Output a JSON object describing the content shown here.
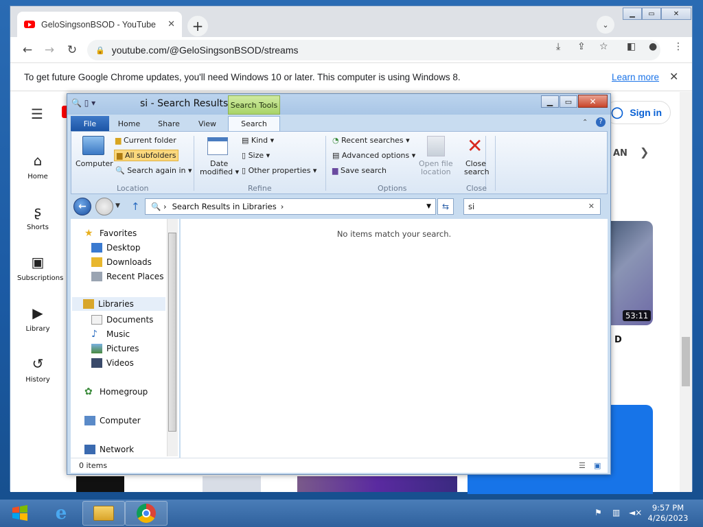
{
  "browser": {
    "tab_title": "GeloSingsonBSOD - YouTube",
    "tab_close": "✕",
    "new_tab": "+",
    "url": "youtube.com/@GeloSingsonBSOD/streams",
    "window_controls": [
      "▁",
      "▭",
      "✕"
    ]
  },
  "infobar": {
    "message": "To get future Google Chrome updates, you'll need Windows 10 or later. This computer is using Windows 8.",
    "learn_more": "Learn more",
    "close": "✕"
  },
  "youtube": {
    "sign_in": "Sign in",
    "sidebar": [
      {
        "label": "Home",
        "icon": "home-icon"
      },
      {
        "label": "Shorts",
        "icon": "shorts-icon"
      },
      {
        "label": "Subscriptions",
        "icon": "subscriptions-icon"
      },
      {
        "label": "Library",
        "icon": "library-icon"
      },
      {
        "label": "History",
        "icon": "history-icon"
      }
    ],
    "chip_text": "AN",
    "video_duration": "53:11",
    "video_title_fragment": "D"
  },
  "explorer": {
    "title": "si - Search Results...",
    "search_tools_label": "Search Tools",
    "ribbon_tabs": [
      "File",
      "Home",
      "Share",
      "View",
      "Search"
    ],
    "ribbon": {
      "computer": "Computer",
      "current_folder": "Current folder",
      "all_subfolders": "All subfolders",
      "search_again_in": "Search again in",
      "location_group": "Location",
      "date_modified_1": "Date",
      "date_modified_2": "modified",
      "kind": "Kind",
      "size": "Size",
      "other_properties": "Other properties",
      "refine_group": "Refine",
      "recent_searches": "Recent searches",
      "advanced_options": "Advanced options",
      "save_search": "Save search",
      "options_group": "Options",
      "open_file_location_1": "Open file",
      "open_file_location_2": "location",
      "close_search_1": "Close",
      "close_search_2": "search",
      "close_group": "Close"
    },
    "address": "Search Results in Libraries",
    "search_value": "si",
    "nav": {
      "favorites": "Favorites",
      "desktop": "Desktop",
      "downloads": "Downloads",
      "recent_places": "Recent Places",
      "libraries": "Libraries",
      "documents": "Documents",
      "music": "Music",
      "pictures": "Pictures",
      "videos": "Videos",
      "homegroup": "Homegroup",
      "computer": "Computer",
      "network": "Network"
    },
    "empty_message": "No items match your search.",
    "status": "0 items"
  },
  "taskbar": {
    "time": "9:57 PM",
    "date": "4/26/2023"
  }
}
